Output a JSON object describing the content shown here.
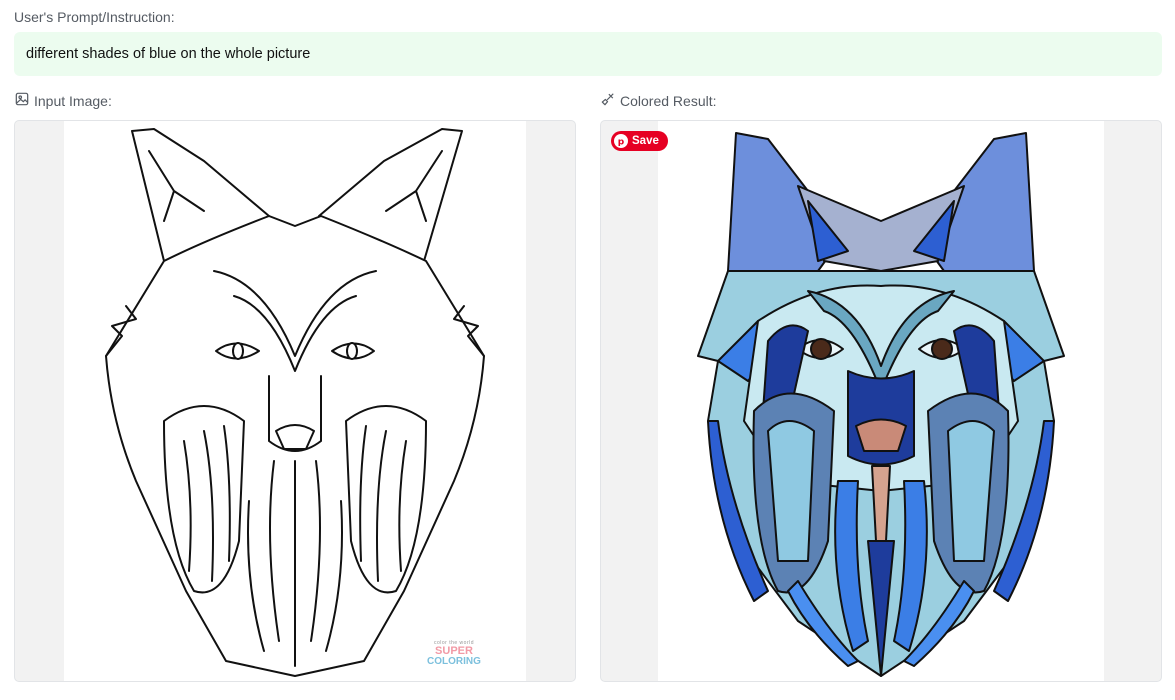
{
  "prompt": {
    "label": "User's Prompt/Instruction:",
    "text": "different shades of blue on the whole picture"
  },
  "input_panel": {
    "title": "Input Image:",
    "icon": "image-icon",
    "watermark": {
      "top": "color the world",
      "main": "SUPER",
      "sub": "COLORING"
    }
  },
  "result_panel": {
    "title": "Colored Result:",
    "icon": "paint-brush-icon",
    "save_label": "Save",
    "save_color": "#e60023",
    "palette": [
      "#6d8fdc",
      "#a5b1d0",
      "#2d5fd2",
      "#c9e9f1",
      "#9bcfe0",
      "#1e3c9c",
      "#3b7ee6",
      "#c98a78"
    ]
  },
  "colors": {
    "prompt_bg": "#ecfcef",
    "panel_bg": "#f2f2f2"
  }
}
